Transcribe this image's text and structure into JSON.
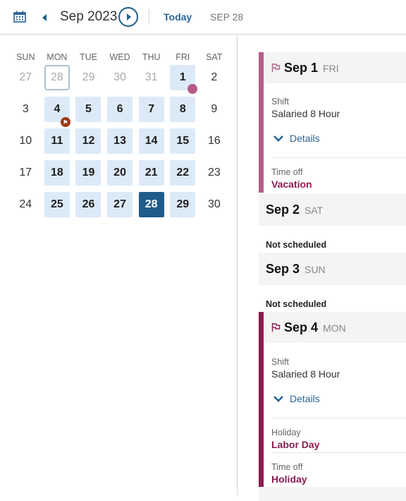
{
  "header": {
    "month_title": "Sep 2023",
    "today_label": "Today",
    "selected_date_label": "SEP 28"
  },
  "calendar": {
    "weekdays": [
      "SUN",
      "MON",
      "TUE",
      "WED",
      "THU",
      "FRI",
      "SAT"
    ],
    "weeks": [
      [
        {
          "d": "27",
          "t": "other"
        },
        {
          "d": "28",
          "t": "other-outlined"
        },
        {
          "d": "29",
          "t": "other"
        },
        {
          "d": "30",
          "t": "other"
        },
        {
          "d": "31",
          "t": "other"
        },
        {
          "d": "1",
          "t": "work",
          "marker": "time-off-dot"
        },
        {
          "d": "2",
          "t": "plain"
        }
      ],
      [
        {
          "d": "3",
          "t": "plain"
        },
        {
          "d": "4",
          "t": "work",
          "marker": "holiday-badge"
        },
        {
          "d": "5",
          "t": "work"
        },
        {
          "d": "6",
          "t": "work"
        },
        {
          "d": "7",
          "t": "work"
        },
        {
          "d": "8",
          "t": "work"
        },
        {
          "d": "9",
          "t": "plain"
        }
      ],
      [
        {
          "d": "10",
          "t": "plain"
        },
        {
          "d": "11",
          "t": "work"
        },
        {
          "d": "12",
          "t": "work"
        },
        {
          "d": "13",
          "t": "work"
        },
        {
          "d": "14",
          "t": "work"
        },
        {
          "d": "15",
          "t": "work"
        },
        {
          "d": "16",
          "t": "plain"
        }
      ],
      [
        {
          "d": "17",
          "t": "plain"
        },
        {
          "d": "18",
          "t": "work"
        },
        {
          "d": "19",
          "t": "work"
        },
        {
          "d": "20",
          "t": "work"
        },
        {
          "d": "21",
          "t": "work"
        },
        {
          "d": "22",
          "t": "work"
        },
        {
          "d": "23",
          "t": "plain"
        }
      ],
      [
        {
          "d": "24",
          "t": "plain"
        },
        {
          "d": "25",
          "t": "work"
        },
        {
          "d": "26",
          "t": "work"
        },
        {
          "d": "27",
          "t": "work"
        },
        {
          "d": "28",
          "t": "selected"
        },
        {
          "d": "29",
          "t": "work"
        },
        {
          "d": "30",
          "t": "plain"
        }
      ]
    ],
    "holiday_badge_glyph": "⚑"
  },
  "agenda": {
    "sep1": {
      "date": "Sep 1",
      "dow": "FRI",
      "shift_label": "Shift",
      "shift_value": "Salaried 8 Hour",
      "details_label": "Details",
      "timeoff_label": "Time off",
      "timeoff_value": "Vacation"
    },
    "sep2": {
      "date": "Sep 2",
      "dow": "SAT",
      "status": "Not scheduled"
    },
    "sep3": {
      "date": "Sep 3",
      "dow": "SUN",
      "status": "Not scheduled"
    },
    "sep4": {
      "date": "Sep 4",
      "dow": "MON",
      "shift_label": "Shift",
      "shift_value": "Salaried 8 Hour",
      "details_label": "Details",
      "holiday_label": "Holiday",
      "holiday_value": "Labor Day",
      "timeoff_label": "Time off",
      "timeoff_value": "Holiday"
    }
  },
  "colors": {
    "accent": "#1f5c8b",
    "link": "#2a6496",
    "timeoff": "#b35e8a",
    "holiday": "#8b1c4f",
    "workday_bg": "#dceaf8"
  }
}
